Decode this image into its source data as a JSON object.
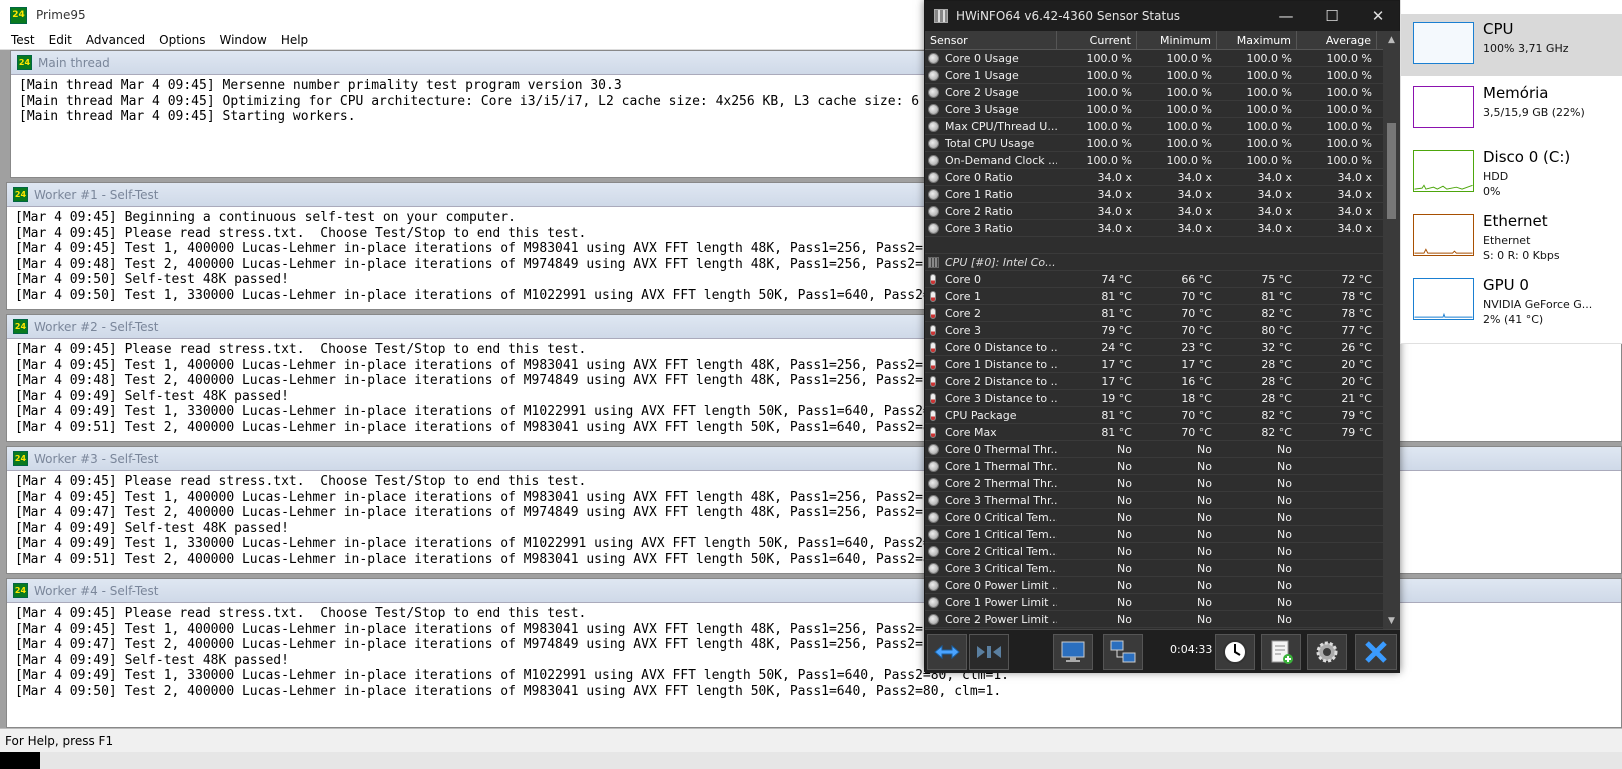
{
  "prime95": {
    "title": "Prime95",
    "logo": "24",
    "menu": [
      "Test",
      "Edit",
      "Advanced",
      "Options",
      "Window",
      "Help"
    ],
    "windows": [
      {
        "title": "Main thread",
        "lines": [
          "[Main thread Mar 4 09:45] Mersenne number primality test program version 30.3",
          "[Main thread Mar 4 09:45] Optimizing for CPU architecture: Core i3/i5/i7, L2 cache size: 4x256 KB, L3 cache size: 6 MB",
          "[Main thread Mar 4 09:45] Starting workers."
        ]
      },
      {
        "title": "Worker #1 - Self-Test",
        "lines": [
          "[Mar 4 09:45] Beginning a continuous self-test on your computer.",
          "[Mar 4 09:45] Please read stress.txt.  Choose Test/Stop to end this test.",
          "[Mar 4 09:45] Test 1, 400000 Lucas-Lehmer in-place iterations of M983041 using AVX FFT length 48K, Pass1=256, Pass2=192, clm=1.",
          "[Mar 4 09:48] Test 2, 400000 Lucas-Lehmer in-place iterations of M974849 using AVX FFT length 48K, Pass1=256, Pass2=192, clm=1.",
          "[Mar 4 09:50] Self-test 48K passed!",
          "[Mar 4 09:50] Test 1, 330000 Lucas-Lehmer in-place iterations of M1022991 using AVX FFT length 50K, Pass1=640, Pass2=80, clm=1."
        ]
      },
      {
        "title": "Worker #2 - Self-Test",
        "lines": [
          "[Mar 4 09:45] Please read stress.txt.  Choose Test/Stop to end this test.",
          "[Mar 4 09:45] Test 1, 400000 Lucas-Lehmer in-place iterations of M983041 using AVX FFT length 48K, Pass1=256, Pass2=192, clm=1.",
          "[Mar 4 09:48] Test 2, 400000 Lucas-Lehmer in-place iterations of M974849 using AVX FFT length 48K, Pass1=256, Pass2=192, clm=1.",
          "[Mar 4 09:49] Self-test 48K passed!",
          "[Mar 4 09:49] Test 1, 330000 Lucas-Lehmer in-place iterations of M1022991 using AVX FFT length 50K, Pass1=640, Pass2=80, clm=1.",
          "[Mar 4 09:51] Test 2, 400000 Lucas-Lehmer in-place iterations of M983041 using AVX FFT length 50K, Pass1=640, Pass2=80, clm=1."
        ]
      },
      {
        "title": "Worker #3 - Self-Test",
        "lines": [
          "[Mar 4 09:45] Please read stress.txt.  Choose Test/Stop to end this test.",
          "[Mar 4 09:45] Test 1, 400000 Lucas-Lehmer in-place iterations of M983041 using AVX FFT length 48K, Pass1=256, Pass2=192, clm=1.",
          "[Mar 4 09:47] Test 2, 400000 Lucas-Lehmer in-place iterations of M974849 using AVX FFT length 48K, Pass1=256, Pass2=192, clm=1.",
          "[Mar 4 09:49] Self-test 48K passed!",
          "[Mar 4 09:49] Test 1, 330000 Lucas-Lehmer in-place iterations of M1022991 using AVX FFT length 50K, Pass1=640, Pass2=80, clm=1.",
          "[Mar 4 09:51] Test 2, 400000 Lucas-Lehmer in-place iterations of M983041 using AVX FFT length 50K, Pass1=640, Pass2=80, clm=1."
        ]
      },
      {
        "title": "Worker #4 - Self-Test",
        "lines": [
          "[Mar 4 09:45] Please read stress.txt.  Choose Test/Stop to end this test.",
          "[Mar 4 09:45] Test 1, 400000 Lucas-Lehmer in-place iterations of M983041 using AVX FFT length 48K, Pass1=256, Pass2=192, clm=1.",
          "[Mar 4 09:47] Test 2, 400000 Lucas-Lehmer in-place iterations of M974849 using AVX FFT length 48K, Pass1=256, Pass2=192, clm=1.",
          "[Mar 4 09:49] Self-test 48K passed!",
          "[Mar 4 09:49] Test 1, 330000 Lucas-Lehmer in-place iterations of M1022991 using AVX FFT length 50K, Pass1=640, Pass2=80, clm=1.",
          "[Mar 4 09:50] Test 2, 400000 Lucas-Lehmer in-place iterations of M983041 using AVX FFT length 50K, Pass1=640, Pass2=80, clm=1."
        ]
      }
    ],
    "status": "For Help, press F1"
  },
  "hwinfo": {
    "title": "HWiNFO64 v6.42-4360 Sensor Status",
    "controls": {
      "minimize": "—",
      "maximize": "☐",
      "close": "✕"
    },
    "headers": [
      "Sensor",
      "Current",
      "Minimum",
      "Maximum",
      "Average"
    ],
    "rows": [
      {
        "icon": "circle",
        "name": "Core 0 Usage",
        "cur": "100.0 %",
        "min": "100.0 %",
        "max": "100.0 %",
        "avg": "100.0 %"
      },
      {
        "icon": "circle",
        "name": "Core 1 Usage",
        "cur": "100.0 %",
        "min": "100.0 %",
        "max": "100.0 %",
        "avg": "100.0 %"
      },
      {
        "icon": "circle",
        "name": "Core 2 Usage",
        "cur": "100.0 %",
        "min": "100.0 %",
        "max": "100.0 %",
        "avg": "100.0 %"
      },
      {
        "icon": "circle",
        "name": "Core 3 Usage",
        "cur": "100.0 %",
        "min": "100.0 %",
        "max": "100.0 %",
        "avg": "100.0 %"
      },
      {
        "icon": "circle",
        "name": "Max CPU/Thread U...",
        "cur": "100.0 %",
        "min": "100.0 %",
        "max": "100.0 %",
        "avg": "100.0 %"
      },
      {
        "icon": "circle",
        "name": "Total CPU Usage",
        "cur": "100.0 %",
        "min": "100.0 %",
        "max": "100.0 %",
        "avg": "100.0 %"
      },
      {
        "icon": "circle",
        "name": "On-Demand Clock ...",
        "cur": "100.0 %",
        "min": "100.0 %",
        "max": "100.0 %",
        "avg": "100.0 %"
      },
      {
        "icon": "circle",
        "name": "Core 0 Ratio",
        "cur": "34.0 x",
        "min": "34.0 x",
        "max": "34.0 x",
        "avg": "34.0 x"
      },
      {
        "icon": "circle",
        "name": "Core 1 Ratio",
        "cur": "34.0 x",
        "min": "34.0 x",
        "max": "34.0 x",
        "avg": "34.0 x"
      },
      {
        "icon": "circle",
        "name": "Core 2 Ratio",
        "cur": "34.0 x",
        "min": "34.0 x",
        "max": "34.0 x",
        "avg": "34.0 x"
      },
      {
        "icon": "circle",
        "name": "Core 3 Ratio",
        "cur": "34.0 x",
        "min": "34.0 x",
        "max": "34.0 x",
        "avg": "34.0 x"
      },
      {
        "icon": "none",
        "name": "",
        "cur": "",
        "min": "",
        "max": "",
        "avg": ""
      },
      {
        "icon": "chip",
        "name": "CPU [#0]: Intel Co...",
        "cur": "",
        "min": "",
        "max": "",
        "avg": "",
        "group": true
      },
      {
        "icon": "temp",
        "name": "Core 0",
        "cur": "74 °C",
        "min": "66 °C",
        "max": "75 °C",
        "avg": "72 °C"
      },
      {
        "icon": "temp",
        "name": "Core 1",
        "cur": "81 °C",
        "min": "70 °C",
        "max": "81 °C",
        "avg": "78 °C"
      },
      {
        "icon": "temp",
        "name": "Core 2",
        "cur": "81 °C",
        "min": "70 °C",
        "max": "82 °C",
        "avg": "78 °C"
      },
      {
        "icon": "temp",
        "name": "Core 3",
        "cur": "79 °C",
        "min": "70 °C",
        "max": "80 °C",
        "avg": "77 °C"
      },
      {
        "icon": "temp",
        "name": "Core 0 Distance to ...",
        "cur": "24 °C",
        "min": "23 °C",
        "max": "32 °C",
        "avg": "26 °C"
      },
      {
        "icon": "temp",
        "name": "Core 1 Distance to ...",
        "cur": "17 °C",
        "min": "17 °C",
        "max": "28 °C",
        "avg": "20 °C"
      },
      {
        "icon": "temp",
        "name": "Core 2 Distance to ...",
        "cur": "17 °C",
        "min": "16 °C",
        "max": "28 °C",
        "avg": "20 °C"
      },
      {
        "icon": "temp",
        "name": "Core 3 Distance to ...",
        "cur": "19 °C",
        "min": "18 °C",
        "max": "28 °C",
        "avg": "21 °C"
      },
      {
        "icon": "temp",
        "name": "CPU Package",
        "cur": "81 °C",
        "min": "70 °C",
        "max": "82 °C",
        "avg": "79 °C"
      },
      {
        "icon": "temp",
        "name": "Core Max",
        "cur": "81 °C",
        "min": "70 °C",
        "max": "82 °C",
        "avg": "79 °C"
      },
      {
        "icon": "circle",
        "name": "Core 0 Thermal Thr...",
        "cur": "No",
        "min": "No",
        "max": "No",
        "avg": ""
      },
      {
        "icon": "circle",
        "name": "Core 1 Thermal Thr...",
        "cur": "No",
        "min": "No",
        "max": "No",
        "avg": ""
      },
      {
        "icon": "circle",
        "name": "Core 2 Thermal Thr...",
        "cur": "No",
        "min": "No",
        "max": "No",
        "avg": ""
      },
      {
        "icon": "circle",
        "name": "Core 3 Thermal Thr...",
        "cur": "No",
        "min": "No",
        "max": "No",
        "avg": ""
      },
      {
        "icon": "circle",
        "name": "Core 0 Critical Tem...",
        "cur": "No",
        "min": "No",
        "max": "No",
        "avg": ""
      },
      {
        "icon": "circle",
        "name": "Core 1 Critical Tem...",
        "cur": "No",
        "min": "No",
        "max": "No",
        "avg": ""
      },
      {
        "icon": "circle",
        "name": "Core 2 Critical Tem...",
        "cur": "No",
        "min": "No",
        "max": "No",
        "avg": ""
      },
      {
        "icon": "circle",
        "name": "Core 3 Critical Tem...",
        "cur": "No",
        "min": "No",
        "max": "No",
        "avg": ""
      },
      {
        "icon": "circle",
        "name": "Core 0 Power Limit ...",
        "cur": "No",
        "min": "No",
        "max": "No",
        "avg": ""
      },
      {
        "icon": "circle",
        "name": "Core 1 Power Limit ...",
        "cur": "No",
        "min": "No",
        "max": "No",
        "avg": ""
      },
      {
        "icon": "circle",
        "name": "Core 2 Power Limit ...",
        "cur": "No",
        "min": "No",
        "max": "No",
        "avg": ""
      }
    ],
    "timer": "0:04:33",
    "toolbar_icons": [
      "expand-arrows-icon",
      "collapse-arrows-icon",
      "monitor-icon",
      "network-icon",
      "clock-icon",
      "report-icon",
      "gear-icon",
      "close-icon"
    ]
  },
  "taskmgr": {
    "items": [
      {
        "name": "CPU",
        "lines": [
          "100% 3,71 GHz"
        ],
        "color": "#1a7fd1",
        "selected": true
      },
      {
        "name": "Memória",
        "lines": [
          "3,5/15,9 GB (22%)"
        ],
        "color": "#8b12ae",
        "selected": false
      },
      {
        "name": "Disco 0 (C:)",
        "lines": [
          "HDD",
          "0%"
        ],
        "color": "#4da60c",
        "selected": false
      },
      {
        "name": "Ethernet",
        "lines": [
          "Ethernet",
          "S: 0 R: 0 Kbps"
        ],
        "color": "#a74f01",
        "selected": false
      },
      {
        "name": "GPU 0",
        "lines": [
          "NVIDIA GeForce G...",
          "2% (41 °C)"
        ],
        "color": "#1a7fd1",
        "selected": false
      }
    ]
  }
}
